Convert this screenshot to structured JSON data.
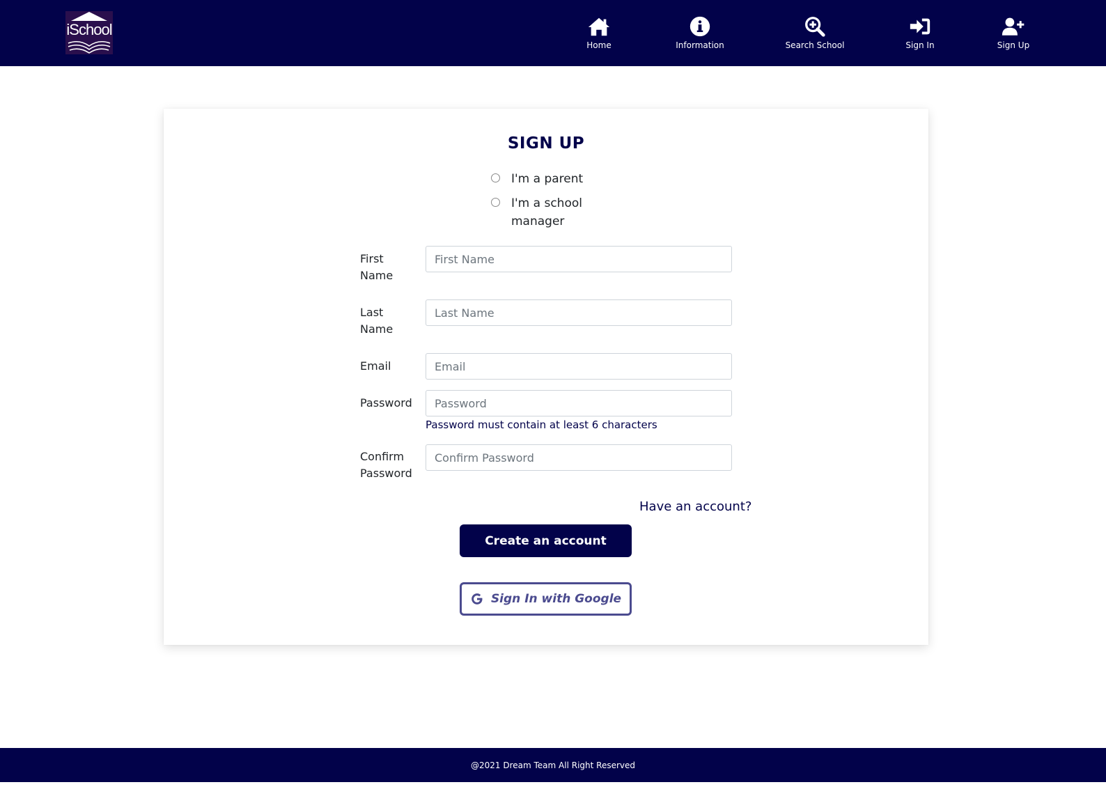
{
  "header": {
    "logo_text": "iSchool",
    "nav": [
      {
        "label": "Home",
        "icon": "home-icon"
      },
      {
        "label": "Information",
        "icon": "info-icon"
      },
      {
        "label": "Search School",
        "icon": "search-plus-icon"
      },
      {
        "label": "Sign In",
        "icon": "sign-in-icon"
      },
      {
        "label": "Sign Up",
        "icon": "user-plus-icon"
      }
    ]
  },
  "form": {
    "title": "SIGN UP",
    "roles": [
      {
        "label": "I'm a parent",
        "checked": false
      },
      {
        "label": "I'm a school manager",
        "checked": false
      }
    ],
    "fields": {
      "first_name": {
        "label": "First Name",
        "placeholder": "First Name",
        "value": ""
      },
      "last_name": {
        "label": "Last Name",
        "placeholder": "Last Name",
        "value": ""
      },
      "email": {
        "label": "Email",
        "placeholder": "Email",
        "value": ""
      },
      "password": {
        "label": "Password",
        "placeholder": "Password",
        "value": ""
      },
      "confirm_password": {
        "label": "Confirm Password",
        "placeholder": "Confirm Password",
        "value": ""
      }
    },
    "password_hint": "Password must contain at least 6 characters",
    "have_account": "Have an account?",
    "create_button": "Create an account",
    "google_button": "Sign In with Google"
  },
  "footer": {
    "text": "@2021 Dream Team All Right Reserved"
  },
  "colors": {
    "primary": "#02024a",
    "google_outline": "#4b4b8f"
  }
}
